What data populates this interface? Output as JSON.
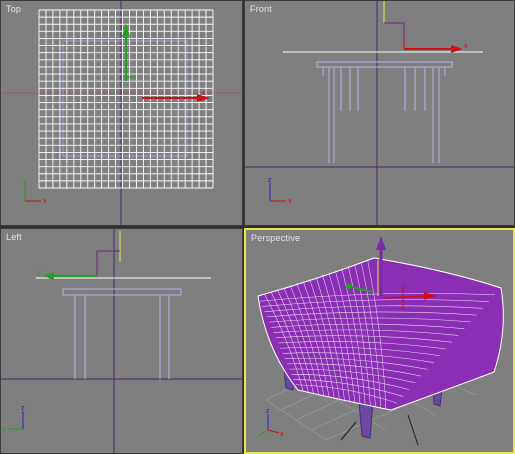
{
  "viewports": {
    "top": {
      "label": "Top"
    },
    "front": {
      "label": "Front"
    },
    "left": {
      "label": "Left"
    },
    "perspective": {
      "label": "Perspective"
    }
  },
  "axis_letters": {
    "x": "x",
    "y": "y",
    "z": "z"
  },
  "colors": {
    "viewport_bg": "#7f7f7f",
    "active_border": "#e8e84a",
    "object_wire": "#ffffff",
    "table_lines": "#b4b0e6",
    "home_grid_axis": "#4a2a6a",
    "gizmo_x": "#cc1111",
    "gizmo_y": "#22a022",
    "gizmo_z": "#2222cc",
    "mesh_fill": "#8a2fb3"
  },
  "icons": {
    "gizmo": "transform-gizmo-icon",
    "axis_tripod": "axis-tripod-icon"
  }
}
